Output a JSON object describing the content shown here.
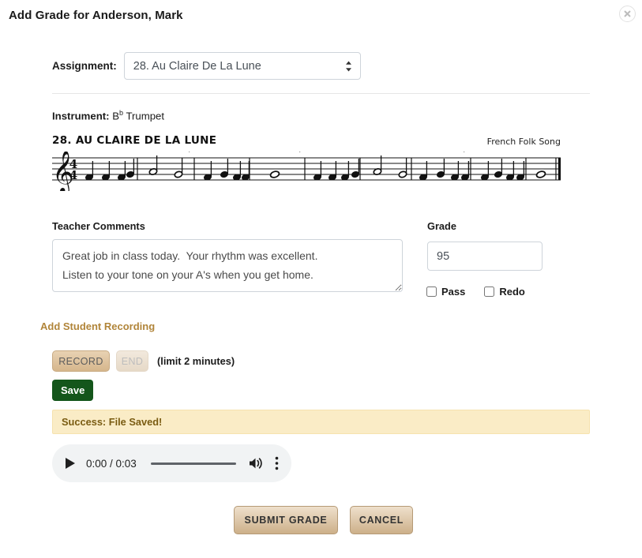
{
  "header": {
    "title": "Add Grade for Anderson, Mark",
    "close_icon": "close-icon"
  },
  "assignment": {
    "label": "Assignment:",
    "selected": "28. Au Claire De La Lune",
    "options": [
      "28. Au Claire De La Lune"
    ]
  },
  "instrument": {
    "label": "Instrument:",
    "pitch": "B",
    "accidental": "b",
    "name": " Trumpet"
  },
  "music": {
    "title": "28.  AU CLAIRE DE LA LUNE",
    "credit": "French Folk Song",
    "time_signature_top": "4",
    "time_signature_bottom": "4",
    "clef": "treble-clef"
  },
  "comments": {
    "label": "Teacher Comments",
    "value": "Great job in class today.  Your rhythm was excellent.\nListen to your tone on your A's when you get home.",
    "placeholder": ""
  },
  "grade": {
    "label": "Grade",
    "value": "95",
    "placeholder": "",
    "pass_label": "Pass",
    "pass_checked": false,
    "redo_label": "Redo",
    "redo_checked": false
  },
  "recording": {
    "section_link": "Add Student Recording",
    "record_label": "RECORD",
    "end_label": "END",
    "limit_note": "(limit 2 minutes)",
    "save_label": "Save",
    "status_message": "Success: File Saved!"
  },
  "audio": {
    "play_icon": "play-icon",
    "time_display": "0:00 / 0:03",
    "current_time": "0:00",
    "duration": "0:03",
    "volume_icon": "volume-icon",
    "menu_icon": "more-options-icon"
  },
  "footer": {
    "submit_label": "SUBMIT GRADE",
    "cancel_label": "CANCEL"
  },
  "colors": {
    "accent_tan": "#b1853a",
    "save_green": "#14561b",
    "banner_bg": "#faecc6",
    "banner_text": "#7a5c12",
    "button_tan": "#cdb089"
  }
}
